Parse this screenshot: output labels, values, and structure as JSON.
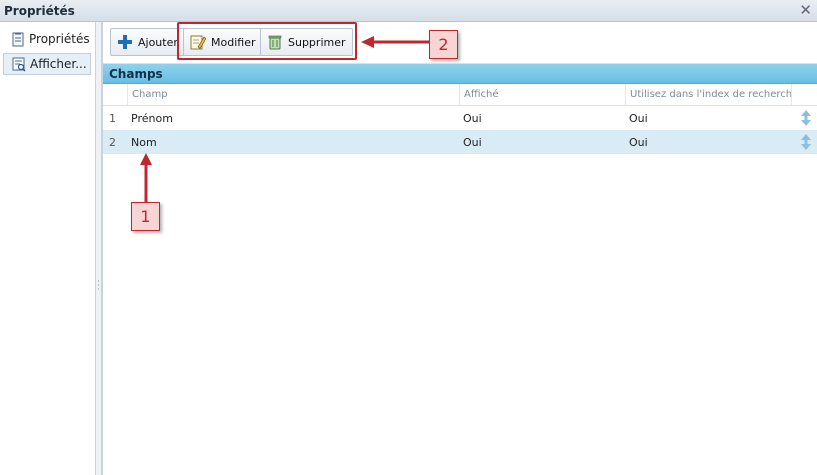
{
  "window": {
    "title": "Propriétés",
    "close_glyph": "✕"
  },
  "sidebar": {
    "items": [
      {
        "label": "Propriétés",
        "icon": "document-icon",
        "active": false
      },
      {
        "label": "Afficher...",
        "icon": "view-list-icon",
        "active": true
      }
    ]
  },
  "toolbar": {
    "add_label": "Ajouter",
    "edit_label": "Modifier",
    "delete_label": "Supprimer"
  },
  "section": {
    "title": "Champs"
  },
  "grid": {
    "columns": [
      "Champ",
      "Affiché",
      "Utilisez dans l'index de recherch"
    ],
    "rows": [
      {
        "num": "1",
        "champ": "Prénom",
        "affiche": "Oui",
        "index": "Oui",
        "selected": false
      },
      {
        "num": "2",
        "champ": "Nom",
        "affiche": "Oui",
        "index": "Oui",
        "selected": true
      }
    ]
  },
  "annotations": {
    "callout1": "1",
    "callout2": "2"
  },
  "colors": {
    "accent_red": "#c0272d",
    "header_blue": "#67bfe4",
    "row_selected": "#d9ebf5"
  }
}
